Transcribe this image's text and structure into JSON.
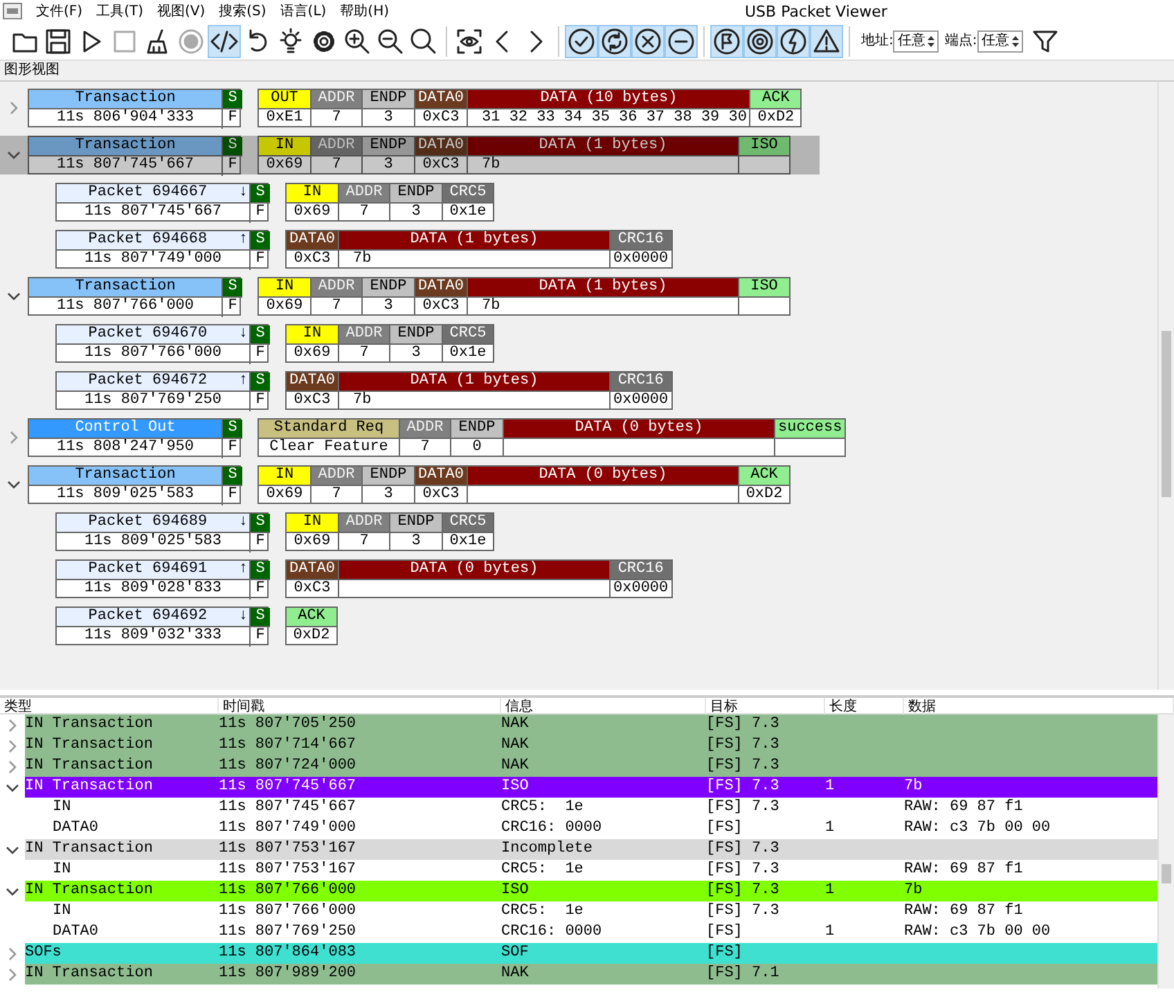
{
  "window": {
    "title": "USB Packet Viewer"
  },
  "menu": [
    "文件(F)",
    "工具(T)",
    "视图(V)",
    "搜索(S)",
    "语言(L)",
    "帮助(H)"
  ],
  "toolbar": {
    "buttons": [
      {
        "pressed": false,
        "disabled": false
      },
      {
        "pressed": false,
        "disabled": false
      },
      {
        "pressed": false,
        "disabled": false
      },
      {
        "pressed": false,
        "disabled": true
      },
      {
        "pressed": false,
        "disabled": false
      },
      {
        "pressed": false,
        "disabled": true
      },
      {
        "pressed": true,
        "disabled": false
      },
      {
        "pressed": false,
        "disabled": false
      },
      {
        "pressed": false,
        "disabled": false
      },
      {
        "pressed": false,
        "disabled": false
      },
      {
        "pressed": false,
        "disabled": false
      },
      {
        "pressed": false,
        "disabled": false
      },
      {
        "pressed": false,
        "disabled": false
      },
      {
        "pressed": false,
        "disabled": false
      },
      {
        "pressed": false,
        "disabled": false
      },
      {
        "pressed": false,
        "disabled": false
      },
      {
        "pressed": true,
        "disabled": false
      },
      {
        "pressed": true,
        "disabled": false
      },
      {
        "pressed": true,
        "disabled": false
      },
      {
        "pressed": true,
        "disabled": false
      },
      {
        "pressed": true,
        "disabled": false
      },
      {
        "pressed": true,
        "disabled": false
      },
      {
        "pressed": true,
        "disabled": false
      },
      {
        "pressed": true,
        "disabled": false
      }
    ],
    "filters": [
      {
        "label": "地址:",
        "value": "任意"
      },
      {
        "label": "端点:",
        "value": "任意"
      }
    ]
  },
  "graph_view": {
    "title": "图形视图",
    "items": [
      {
        "kind": "transaction",
        "expanded": false,
        "selected": false,
        "title": "Transaction",
        "flag_top": "S",
        "time": "11s 806'904'333",
        "flag_bottom": "F",
        "fields": [
          {
            "kind": "token",
            "label": "OUT",
            "value": "0xE1"
          },
          {
            "kind": "addr",
            "label": "ADDR",
            "value": "7"
          },
          {
            "kind": "endp",
            "label": "ENDP",
            "value": "3"
          },
          {
            "kind": "data_pid",
            "label": "DATA0",
            "value": "0xC3"
          },
          {
            "kind": "data",
            "label": "DATA (10 bytes)",
            "value": "31 32 33 34 35 36 37 38 39 30"
          },
          {
            "kind": "handshake",
            "label": "ACK",
            "value": "0xD2"
          }
        ]
      },
      {
        "kind": "transaction",
        "expanded": true,
        "selected": true,
        "title": "Transaction",
        "flag_top": "S",
        "time": "11s 807'745'667",
        "flag_bottom": "F",
        "fields": [
          {
            "kind": "token",
            "label": "IN",
            "value": "0x69"
          },
          {
            "kind": "addr",
            "label": "ADDR",
            "value": "7"
          },
          {
            "kind": "endp",
            "label": "ENDP",
            "value": "3"
          },
          {
            "kind": "data_pid",
            "label": "DATA0",
            "value": "0xC3"
          },
          {
            "kind": "data",
            "label": "DATA (1 bytes)",
            "value": "7b"
          },
          {
            "kind": "handshake",
            "label": "ISO"
          }
        ],
        "children": [
          {
            "kind": "packet",
            "title": "Packet 694667",
            "direction": "↓",
            "flag_top": "S",
            "time": "11s 807'745'667",
            "flag_bottom": "F",
            "fields": [
              {
                "kind": "token",
                "label": "IN",
                "value": "0x69"
              },
              {
                "kind": "addr",
                "label": "ADDR",
                "value": "7"
              },
              {
                "kind": "endp",
                "label": "ENDP",
                "value": "3"
              },
              {
                "kind": "crc",
                "label": "CRC5",
                "value": "0x1e"
              }
            ]
          },
          {
            "kind": "packet",
            "title": "Packet 694668",
            "direction": "↑",
            "flag_top": "S",
            "time": "11s 807'749'000",
            "flag_bottom": "F",
            "fields": [
              {
                "kind": "data_pid",
                "label": "DATA0",
                "value": "0xC3"
              },
              {
                "kind": "data",
                "label": "DATA (1 bytes)",
                "value": "7b"
              },
              {
                "kind": "crc",
                "label": "CRC16",
                "value": "0x0000"
              }
            ]
          }
        ]
      },
      {
        "kind": "transaction",
        "expanded": true,
        "selected": false,
        "title": "Transaction",
        "flag_top": "S",
        "time": "11s 807'766'000",
        "flag_bottom": "F",
        "fields": [
          {
            "kind": "token",
            "label": "IN",
            "value": "0x69"
          },
          {
            "kind": "addr",
            "label": "ADDR",
            "value": "7"
          },
          {
            "kind": "endp",
            "label": "ENDP",
            "value": "3"
          },
          {
            "kind": "data_pid",
            "label": "DATA0",
            "value": "0xC3"
          },
          {
            "kind": "data",
            "label": "DATA (1 bytes)",
            "value": "7b"
          },
          {
            "kind": "handshake",
            "label": "ISO"
          }
        ],
        "children": [
          {
            "kind": "packet",
            "title": "Packet 694670",
            "direction": "↓",
            "flag_top": "S",
            "time": "11s 807'766'000",
            "flag_bottom": "F",
            "fields": [
              {
                "kind": "token",
                "label": "IN",
                "value": "0x69"
              },
              {
                "kind": "addr",
                "label": "ADDR",
                "value": "7"
              },
              {
                "kind": "endp",
                "label": "ENDP",
                "value": "3"
              },
              {
                "kind": "crc",
                "label": "CRC5",
                "value": "0x1e"
              }
            ]
          },
          {
            "kind": "packet",
            "title": "Packet 694672",
            "direction": "↑",
            "flag_top": "S",
            "time": "11s 807'769'250",
            "flag_bottom": "F",
            "fields": [
              {
                "kind": "data_pid",
                "label": "DATA0",
                "value": "0xC3"
              },
              {
                "kind": "data",
                "label": "DATA (1 bytes)",
                "value": "7b"
              },
              {
                "kind": "crc",
                "label": "CRC16",
                "value": "0x0000"
              }
            ]
          }
        ]
      },
      {
        "kind": "control",
        "expanded": false,
        "selected": false,
        "title": "Control Out",
        "flag_top": "S",
        "time": "11s 808'247'950",
        "flag_bottom": "F",
        "fields": [
          {
            "kind": "request",
            "label": "Standard Req",
            "value": "Clear Feature"
          },
          {
            "kind": "addr",
            "label": "ADDR",
            "value": "7"
          },
          {
            "kind": "endp",
            "label": "ENDP",
            "value": "0"
          },
          {
            "kind": "data",
            "label": "DATA (0 bytes)"
          },
          {
            "kind": "handshake",
            "label": "success"
          }
        ]
      },
      {
        "kind": "transaction",
        "expanded": true,
        "selected": false,
        "title": "Transaction",
        "flag_top": "S",
        "time": "11s 809'025'583",
        "flag_bottom": "F",
        "fields": [
          {
            "kind": "token",
            "label": "IN",
            "value": "0x69"
          },
          {
            "kind": "addr",
            "label": "ADDR",
            "value": "7"
          },
          {
            "kind": "endp",
            "label": "ENDP",
            "value": "3"
          },
          {
            "kind": "data_pid",
            "label": "DATA0",
            "value": "0xC3"
          },
          {
            "kind": "data",
            "label": "DATA (0 bytes)"
          },
          {
            "kind": "handshake",
            "label": "ACK",
            "value": "0xD2"
          }
        ],
        "children": [
          {
            "kind": "packet",
            "title": "Packet 694689",
            "direction": "↓",
            "flag_top": "S",
            "time": "11s 809'025'583",
            "flag_bottom": "F",
            "fields": [
              {
                "kind": "token",
                "label": "IN",
                "value": "0x69"
              },
              {
                "kind": "addr",
                "label": "ADDR",
                "value": "7"
              },
              {
                "kind": "endp",
                "label": "ENDP",
                "value": "3"
              },
              {
                "kind": "crc",
                "label": "CRC5",
                "value": "0x1e"
              }
            ]
          },
          {
            "kind": "packet",
            "title": "Packet 694691",
            "direction": "↑",
            "flag_top": "S",
            "time": "11s 809'028'833",
            "flag_bottom": "F",
            "fields": [
              {
                "kind": "data_pid",
                "label": "DATA0",
                "value": "0xC3"
              },
              {
                "kind": "data",
                "label": "DATA (0 bytes)"
              },
              {
                "kind": "crc",
                "label": "CRC16",
                "value": "0x0000"
              }
            ]
          },
          {
            "kind": "packet",
            "title": "Packet 694692",
            "direction": "↓",
            "flag_top": "S",
            "time": "11s 809'032'333",
            "flag_bottom": "F",
            "fields": [
              {
                "kind": "handshake",
                "label": "ACK",
                "value": "0xD2"
              }
            ]
          }
        ]
      }
    ]
  },
  "table": {
    "columns": [
      "类型",
      "时间戳",
      "信息",
      "目标",
      "长度",
      "数据"
    ],
    "rows": [
      {
        "expanded": false,
        "selected": false,
        "color": "#8fbc8f",
        "type": "IN Transaction",
        "timestamp": "11s 807'705'250",
        "info": "NAK",
        "target": "[FS] 7.3"
      },
      {
        "expanded": false,
        "selected": false,
        "color": "#8fbc8f",
        "type": "IN Transaction",
        "timestamp": "11s 807'714'667",
        "info": "NAK",
        "target": "[FS] 7.3"
      },
      {
        "expanded": false,
        "selected": false,
        "color": "#8fbc8f",
        "type": "IN Transaction",
        "timestamp": "11s 807'724'000",
        "info": "NAK",
        "target": "[FS] 7.3"
      },
      {
        "expanded": true,
        "selected": true,
        "type": "IN Transaction",
        "timestamp": "11s 807'745'667",
        "info": "ISO",
        "target": "[FS] 7.3",
        "length": "1",
        "data": "7b",
        "children": [
          {
            "type": "IN",
            "timestamp": "11s 807'745'667",
            "info": "CRC5:  1e",
            "target": "[FS] 7.3",
            "data": "RAW: 69 87 f1"
          },
          {
            "type": "DATA0",
            "timestamp": "11s 807'749'000",
            "info": "CRC16: 0000",
            "target": "[FS]",
            "length": "1",
            "data": "RAW: c3 7b 00 00"
          }
        ]
      },
      {
        "expanded": true,
        "selected": false,
        "color": "#d9d9d9",
        "type": "IN Transaction",
        "timestamp": "11s 807'753'167",
        "info": "Incomplete",
        "target": "[FS] 7.3",
        "children": [
          {
            "type": "IN",
            "timestamp": "11s 807'753'167",
            "info": "CRC5:  1e",
            "target": "[FS] 7.3",
            "data": "RAW: 69 87 f1"
          }
        ]
      },
      {
        "expanded": true,
        "selected": false,
        "color": "#80ff00",
        "type": "IN Transaction",
        "timestamp": "11s 807'766'000",
        "info": "ISO",
        "target": "[FS] 7.3",
        "length": "1",
        "data": "7b",
        "children": [
          {
            "type": "IN",
            "timestamp": "11s 807'766'000",
            "info": "CRC5:  1e",
            "target": "[FS] 7.3",
            "data": "RAW: 69 87 f1"
          },
          {
            "type": "DATA0",
            "timestamp": "11s 807'769'250",
            "info": "CRC16: 0000",
            "target": "[FS]",
            "length": "1",
            "data": "RAW: c3 7b 00 00"
          }
        ]
      },
      {
        "expanded": false,
        "selected": false,
        "color": "#40e0d0",
        "type": "SOFs",
        "timestamp": "11s 807'864'083",
        "info": "SOF",
        "target": "[FS]"
      },
      {
        "expanded": false,
        "selected": false,
        "color": "#8fbc8f",
        "type": "IN Transaction",
        "timestamp": "11s 807'989'200",
        "info": "NAK",
        "target": "[FS] 7.1"
      }
    ]
  }
}
